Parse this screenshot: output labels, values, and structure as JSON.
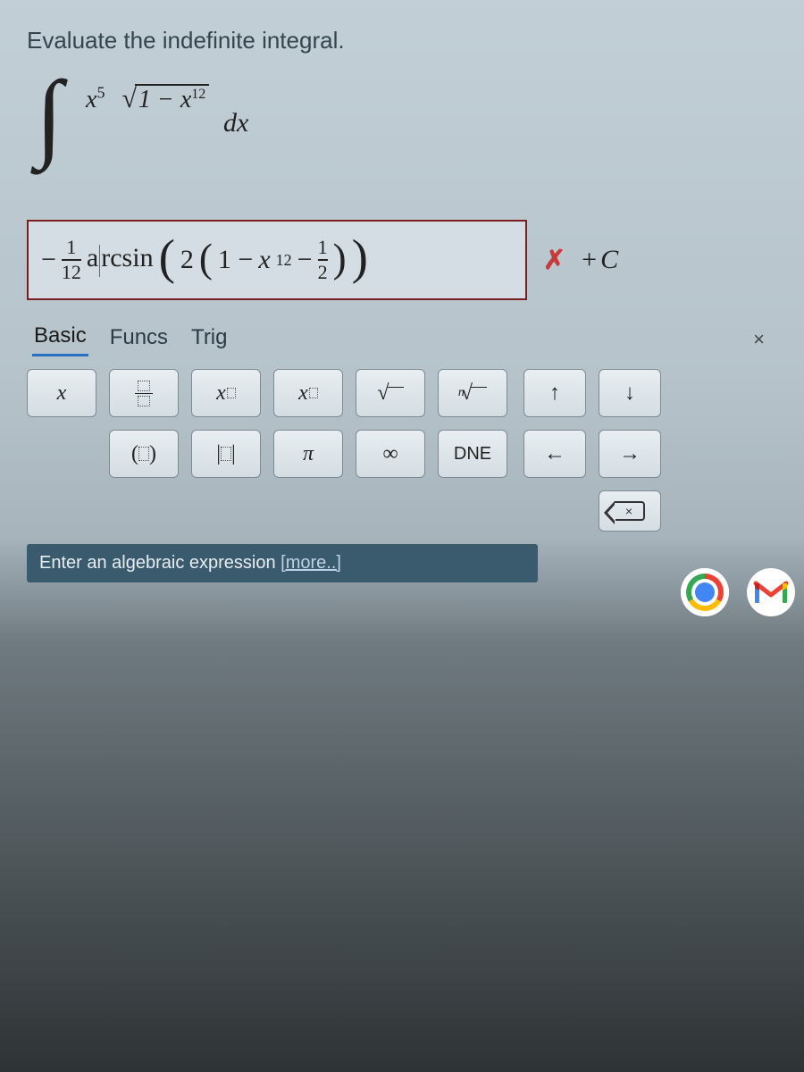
{
  "prompt": "Evaluate the indefinite integral.",
  "integral": {
    "numerator_base": "x",
    "numerator_exp": "5",
    "denom_inside_base": "x",
    "denom_inside_exp": "12",
    "denom_prefix": "1 − ",
    "dx": "dx"
  },
  "answer": {
    "leading_minus": "−",
    "frac1_num": "1",
    "frac1_den": "12",
    "func": "arcsin",
    "mult": "2",
    "inner_prefix": "1 − ",
    "inner_base": "x",
    "inner_exp": "12",
    "inner_minus": " − ",
    "frac2_num": "1",
    "frac2_den": "2"
  },
  "feedback": {
    "correct": false,
    "mark": "✗",
    "suffix_plus": "+",
    "suffix_C": "C"
  },
  "tabs": {
    "items": [
      "Basic",
      "Funcs",
      "Trig"
    ],
    "active_index": 0,
    "close": "×"
  },
  "keys": {
    "r1": [
      "x",
      "frac",
      "xsup",
      "xsub",
      "sqrt",
      "nroot"
    ],
    "r2": [
      "",
      "paren",
      "abs",
      "π",
      "∞",
      "DNE"
    ],
    "nav": [
      "↑",
      "↓",
      "←",
      "→"
    ]
  },
  "hint": {
    "prefix": "Enter an algebraic expression ",
    "link": "[more..]"
  },
  "backspace_x": "×"
}
